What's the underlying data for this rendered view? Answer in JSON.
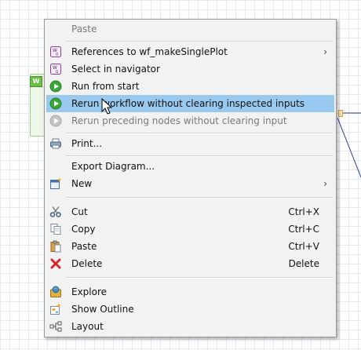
{
  "canvas": {
    "node_tag": "W"
  },
  "menu": {
    "items": [
      {
        "label": "Paste",
        "icon": "none"
      },
      {
        "label": "References to wf_makeSinglePlot",
        "icon": "workflow-reference-icon",
        "submenu": true
      },
      {
        "label": "Select in navigator",
        "icon": "workflow-reference-icon"
      },
      {
        "label": "Run from start",
        "icon": "play-icon"
      },
      {
        "label": "Rerun workflow without clearing inspected inputs",
        "icon": "play-icon",
        "highlighted": true
      },
      {
        "label": "Rerun preceding nodes without clearing input",
        "icon": "play-disabled-icon",
        "disabled": true
      },
      {
        "label": "Print...",
        "icon": "printer-icon"
      },
      {
        "label": "Export Diagram...",
        "icon": "none"
      },
      {
        "label": "New",
        "icon": "new-element-icon",
        "submenu": true
      },
      {
        "label": "Cut",
        "shortcut": "Ctrl+X",
        "icon": "scissors-icon"
      },
      {
        "label": "Copy",
        "shortcut": "Ctrl+C",
        "icon": "copy-icon"
      },
      {
        "label": "Paste",
        "shortcut": "Ctrl+V",
        "icon": "clipboard-icon"
      },
      {
        "label": "Delete",
        "shortcut": "Delete",
        "icon": "delete-x-icon"
      },
      {
        "label": "Explore",
        "icon": "explore-icon"
      },
      {
        "label": "Show Outline",
        "icon": "outline-icon"
      },
      {
        "label": "Layout",
        "icon": "layout-icon"
      }
    ]
  },
  "colors": {
    "highlight": "#99c9ef",
    "menu_background": "#f2f2f2",
    "play_green": "#3aa838",
    "delete_red": "#d9262c"
  }
}
